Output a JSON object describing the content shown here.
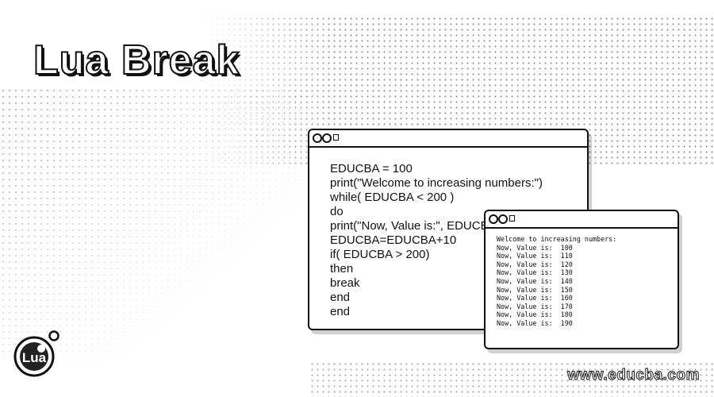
{
  "title": "Lua Break",
  "code_window": {
    "lines": [
      "EDUCBA = 100",
      "print(\"Welcome to increasing numbers:\")",
      "while( EDUCBA < 200 )",
      "do",
      "print(\"Now, Value is:\", EDUCBA)",
      "EDUCBA=EDUCBA+10",
      "if( EDUCBA > 200)",
      "then",
      "break",
      "end",
      "end"
    ]
  },
  "console_window": {
    "lines": [
      "Welcome to increasing numbers:",
      "Now, Value is:  100",
      "Now, Value is:  110",
      "Now, Value is:  120",
      "Now, Value is:  130",
      "Now, Value is:  140",
      "Now, Value is:  150",
      "Now, Value is:  160",
      "Now, Value is:  170",
      "Now, Value is:  180",
      "Now, Value is:  190"
    ]
  },
  "logo": {
    "text": "Lua"
  },
  "url": "www.educba.com"
}
